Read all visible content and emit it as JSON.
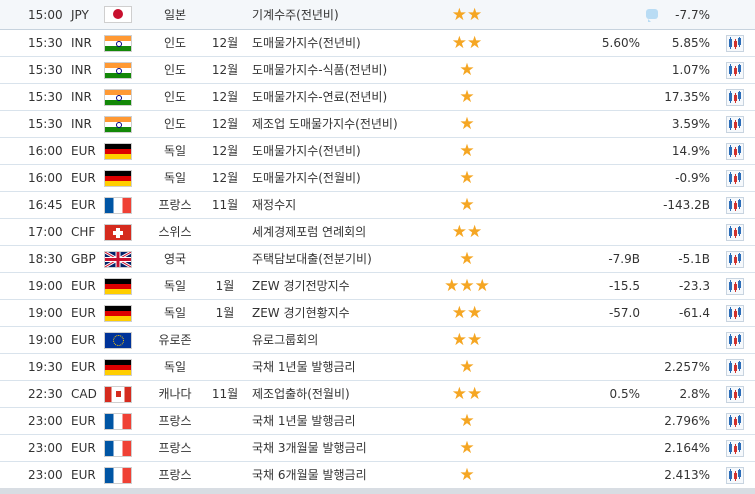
{
  "rows": [
    {
      "time": "15:00",
      "currency": "JPY",
      "flag": "jp",
      "country": "일본",
      "period": "",
      "event": "기계수주(전년비)",
      "stars": "★★",
      "actual": "",
      "previous": "-7.7%",
      "comment": true
    },
    {
      "time": "15:30",
      "currency": "INR",
      "flag": "in",
      "country": "인도",
      "period": "12월",
      "event": "도매물가지수(전년비)",
      "stars": "★★",
      "actual": "5.60%",
      "previous": "5.85%"
    },
    {
      "time": "15:30",
      "currency": "INR",
      "flag": "in",
      "country": "인도",
      "period": "12월",
      "event": "도매물가지수-식품(전년비)",
      "stars": "★",
      "actual": "",
      "previous": "1.07%"
    },
    {
      "time": "15:30",
      "currency": "INR",
      "flag": "in",
      "country": "인도",
      "period": "12월",
      "event": "도매물가지수-연료(전년비)",
      "stars": "★",
      "actual": "",
      "previous": "17.35%"
    },
    {
      "time": "15:30",
      "currency": "INR",
      "flag": "in",
      "country": "인도",
      "period": "12월",
      "event": "제조업 도매물가지수(전년비)",
      "stars": "★",
      "actual": "",
      "previous": "3.59%"
    },
    {
      "time": "16:00",
      "currency": "EUR",
      "flag": "de",
      "country": "독일",
      "period": "12월",
      "event": "도매물가지수(전년비)",
      "stars": "★",
      "actual": "",
      "previous": "14.9%"
    },
    {
      "time": "16:00",
      "currency": "EUR",
      "flag": "de",
      "country": "독일",
      "period": "12월",
      "event": "도매물가지수(전월비)",
      "stars": "★",
      "actual": "",
      "previous": "-0.9%"
    },
    {
      "time": "16:45",
      "currency": "EUR",
      "flag": "fr",
      "country": "프랑스",
      "period": "11월",
      "event": "재정수지",
      "stars": "★",
      "actual": "",
      "previous": "-143.2B"
    },
    {
      "time": "17:00",
      "currency": "CHF",
      "flag": "ch",
      "country": "스위스",
      "period": "",
      "event": "세계경제포럼 연례회의",
      "stars": "★★",
      "actual": "",
      "previous": ""
    },
    {
      "time": "18:30",
      "currency": "GBP",
      "flag": "gb",
      "country": "영국",
      "period": "",
      "event": "주택담보대출(전분기비)",
      "stars": "★",
      "actual": "-7.9B",
      "previous": "-5.1B"
    },
    {
      "time": "19:00",
      "currency": "EUR",
      "flag": "de",
      "country": "독일",
      "period": "1월",
      "event": "ZEW 경기전망지수",
      "stars": "★★★",
      "actual": "-15.5",
      "previous": "-23.3"
    },
    {
      "time": "19:00",
      "currency": "EUR",
      "flag": "de",
      "country": "독일",
      "period": "1월",
      "event": "ZEW 경기현황지수",
      "stars": "★★",
      "actual": "-57.0",
      "previous": "-61.4"
    },
    {
      "time": "19:00",
      "currency": "EUR",
      "flag": "eu",
      "country": "유로존",
      "period": "",
      "event": "유로그룹회의",
      "stars": "★★",
      "actual": "",
      "previous": ""
    },
    {
      "time": "19:30",
      "currency": "EUR",
      "flag": "de",
      "country": "독일",
      "period": "",
      "event": "국채 1년물 발행금리",
      "stars": "★",
      "actual": "",
      "previous": "2.257%"
    },
    {
      "time": "22:30",
      "currency": "CAD",
      "flag": "ca",
      "country": "캐나다",
      "period": "11월",
      "event": "제조업출하(전월비)",
      "stars": "★★",
      "actual": "0.5%",
      "previous": "2.8%"
    },
    {
      "time": "23:00",
      "currency": "EUR",
      "flag": "fr",
      "country": "프랑스",
      "period": "",
      "event": "국채 1년물 발행금리",
      "stars": "★",
      "actual": "",
      "previous": "2.796%"
    },
    {
      "time": "23:00",
      "currency": "EUR",
      "flag": "fr",
      "country": "프랑스",
      "period": "",
      "event": "국채 3개월물 발행금리",
      "stars": "★",
      "actual": "",
      "previous": "2.164%"
    },
    {
      "time": "23:00",
      "currency": "EUR",
      "flag": "fr",
      "country": "프랑스",
      "period": "",
      "event": "국채 6개월물 발행금리",
      "stars": "★",
      "actual": "",
      "previous": "2.413%"
    }
  ],
  "colors": {
    "star": "#f5a623",
    "border": "#d9e3ec"
  },
  "icons": {
    "chart": "chart-icon",
    "comment": "comment-icon"
  }
}
